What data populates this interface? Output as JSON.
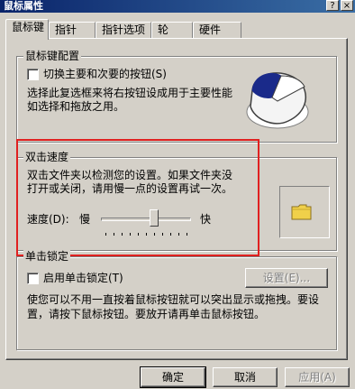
{
  "window": {
    "title": "鼠标属性",
    "help_button": "?",
    "close_button": "×"
  },
  "tabs": [
    {
      "label": "鼠标键"
    },
    {
      "label": "指针"
    },
    {
      "label": "指针选项"
    },
    {
      "label": "轮"
    },
    {
      "label": "硬件"
    }
  ],
  "button_config": {
    "legend": "鼠标键配置",
    "checkbox_label": "切换主要和次要的按钮(S)",
    "description_line1": "选择此复选框来将右按钮设成用于主要性能",
    "description_line2": "如选择和拖放之用。"
  },
  "double_click": {
    "legend": "双击速度",
    "description_line1": "双击文件夹以检测您的设置。如果文件夹没",
    "description_line2": "打开或关闭，请用慢一点的设置再试一次。",
    "speed_label": "速度(D):",
    "slow_label": "慢",
    "fast_label": "快",
    "speed_level": 0.6
  },
  "click_lock": {
    "legend": "单击锁定",
    "checkbox_label": "启用单击锁定(T)",
    "settings_button": "设置(E)...",
    "description_line1": "使您可以不用一直按着鼠标按钮就可以突出显示或拖拽。要设",
    "description_line2": "置，请按下鼠标按钮。要放开请再单击鼠标按钮。"
  },
  "footer": {
    "ok": "确定",
    "cancel": "取消",
    "apply": "应用(A)"
  },
  "colors": {
    "title_active": "#0a246a",
    "highlight": "#e02020",
    "folder": "#f0d04a"
  }
}
